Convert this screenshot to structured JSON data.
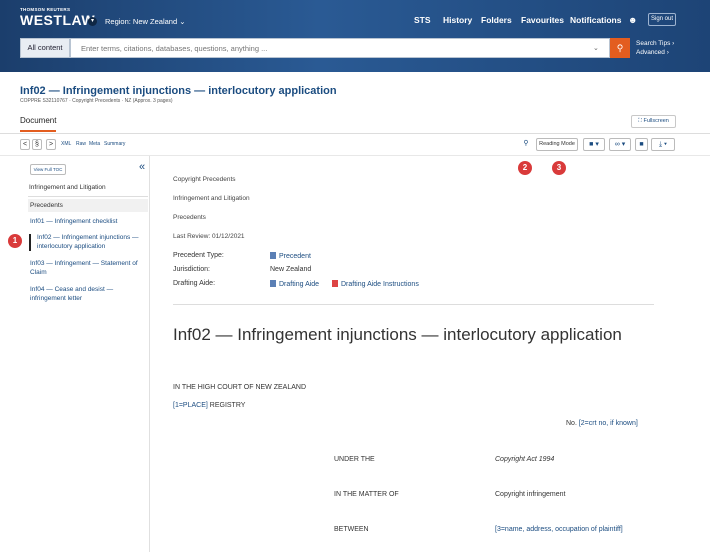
{
  "header": {
    "brand_top": "THOMSON REUTERS",
    "brand": "WESTLAW",
    "region": "Region: New Zealand",
    "region_chevron": "⌄",
    "nav": {
      "sts": "STS",
      "history": "History",
      "folders": "Folders",
      "favourites": "Favourites",
      "notifications": "Notifications"
    },
    "user_icon": "user-icon",
    "sign_out": "Sign out"
  },
  "search": {
    "scope": "All content",
    "placeholder": "Enter terms, citations, databases, questions, anything ...",
    "tips": "Search Tips",
    "advanced": "Advanced"
  },
  "document": {
    "title": "Inf02 — Infringement injunctions — interlocutory application",
    "subtitle": "COPPRE S32110767 · Copyright Precedents · NZ (Approx. 3 pages)",
    "tab": "Document",
    "fullscreen": "Fullscreen"
  },
  "toolbar": {
    "prev": "<",
    "section": "§",
    "next": ">",
    "xml": "XML",
    "raw": "Raw",
    "meta": "Meta",
    "summary": "Summary",
    "reading_mode": "Reading Mode"
  },
  "toc": {
    "view_full": "View Full TOC",
    "collapse": "«",
    "heading": "Infringement and Litigation",
    "section": "Precedents",
    "items": [
      "Inf01 — Infringement checklist",
      "Inf02 — Infringement injunctions — interlocutory application",
      "Inf03 — Infringement — Statement of Claim",
      "Inf04 — Cease and desist — infringement letter"
    ]
  },
  "annotations": {
    "one": "1",
    "two": "2",
    "three": "3"
  },
  "meta": {
    "lines": [
      "Copyright Precedents",
      "Infringement and Litigation",
      "Precedents",
      "Last Review: 01/12/2021"
    ],
    "precedent_type_label": "Precedent Type:",
    "precedent_type_value": "Precedent",
    "jurisdiction_label": "Jurisdiction:",
    "jurisdiction_value": "New Zealand",
    "drafting_label": "Drafting Aide:",
    "drafting_value1": "Drafting Aide",
    "drafting_value2": "Drafting Aide Instructions"
  },
  "body": {
    "heading": "Inf02 — Infringement injunctions — interlocutory application",
    "court": "IN THE HIGH COURT OF NEW ZEALAND",
    "place": "[1=PLACE]",
    "registry": " REGISTRY",
    "no_label": "No. ",
    "no_value": "[2=crt no, if known]",
    "under": "UNDER THE",
    "under_value": "Copyright Act 1994",
    "matter": "IN THE MATTER OF",
    "matter_value": "Copyright infringement",
    "between": "BETWEEN",
    "between_value": "[3=name, address, occupation of plaintiff]"
  }
}
